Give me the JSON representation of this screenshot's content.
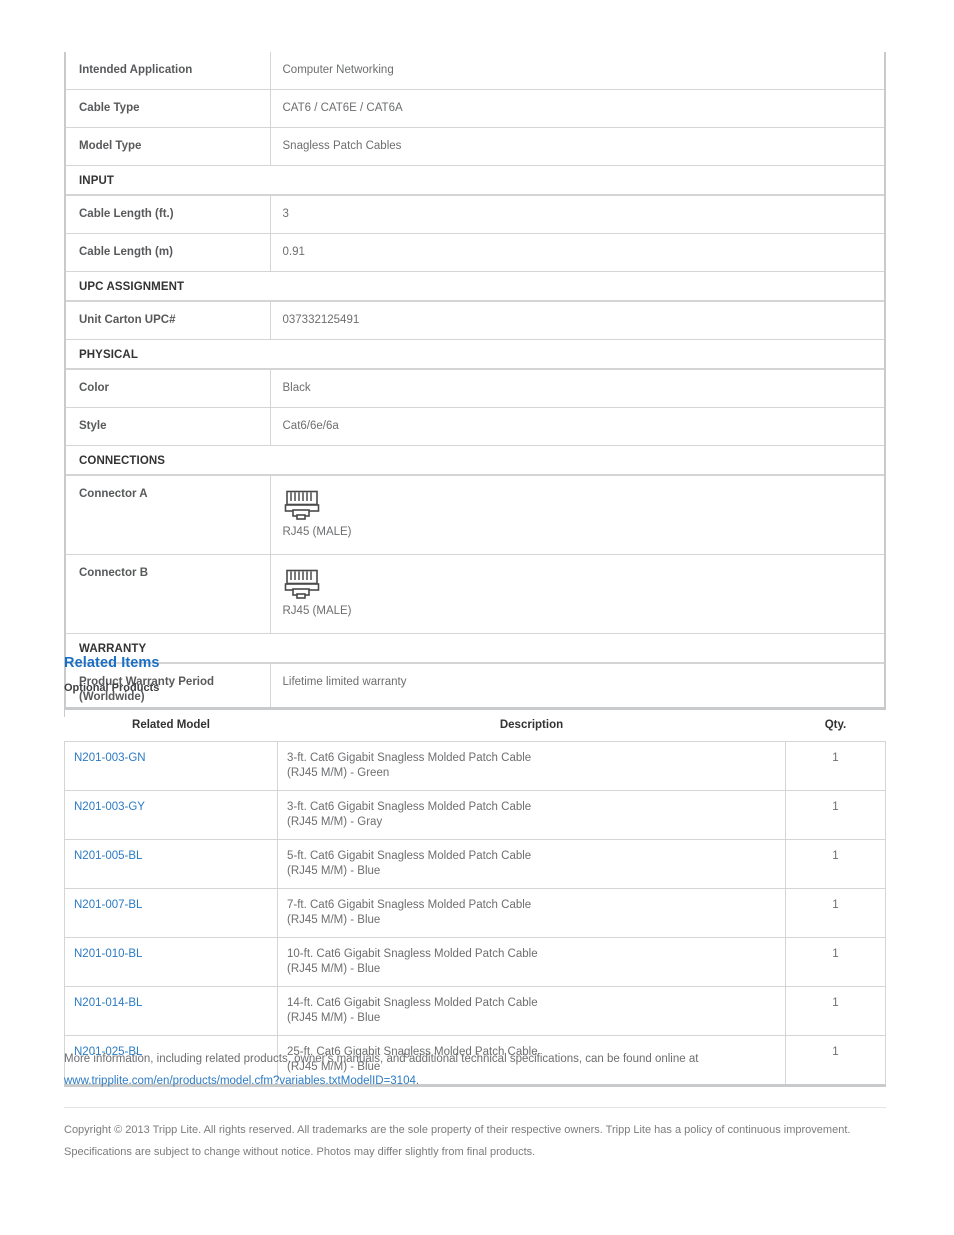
{
  "spec_table": {
    "rows": [
      {
        "kind": "row",
        "label": "Intended Application",
        "value": "Computer Networking"
      },
      {
        "kind": "row",
        "label": "Cable Type",
        "value": "CAT6 / CAT6E / CAT6A"
      },
      {
        "kind": "row",
        "label": "Model Type",
        "value": "Snagless Patch Cables"
      },
      {
        "kind": "section",
        "label": "INPUT"
      },
      {
        "kind": "row",
        "label": "Cable Length (ft.)",
        "value": "3"
      },
      {
        "kind": "row",
        "label": "Cable Length (m)",
        "value": "0.91"
      },
      {
        "kind": "section",
        "label": "UPC ASSIGNMENT"
      },
      {
        "kind": "row",
        "label": "Unit Carton UPC#",
        "value": "037332125491"
      },
      {
        "kind": "section",
        "label": "PHYSICAL"
      },
      {
        "kind": "row",
        "label": "Color",
        "value": "Black"
      },
      {
        "kind": "row",
        "label": "Style",
        "value": "Cat6/6e/6a"
      },
      {
        "kind": "section",
        "label": "CONNECTIONS"
      },
      {
        "kind": "connector",
        "label": "Connector A",
        "value": "RJ45 (MALE)",
        "icon": "rj45-connector-icon"
      },
      {
        "kind": "connector",
        "label": "Connector B",
        "value": "RJ45 (MALE)",
        "icon": "rj45-connector-icon"
      },
      {
        "kind": "section",
        "label": "WARRANTY"
      },
      {
        "kind": "row",
        "label": "Product Warranty Period (Worldwide)",
        "value": "Lifetime limited warranty"
      }
    ]
  },
  "related": {
    "heading": "Related Items",
    "subheading": "Optional Products",
    "columns": [
      "Related Model",
      "Description",
      "Qty."
    ],
    "rows": [
      {
        "model": "N201-003-GN",
        "description": "3-ft. Cat6 Gigabit Snagless Molded Patch Cable (RJ45 M/M) - Green",
        "qty": "1"
      },
      {
        "model": "N201-003-GY",
        "description": "3-ft. Cat6 Gigabit Snagless Molded Patch Cable (RJ45 M/M) - Gray",
        "qty": "1"
      },
      {
        "model": "N201-005-BL",
        "description": "5-ft. Cat6 Gigabit Snagless Molded Patch Cable (RJ45 M/M) - Blue",
        "qty": "1"
      },
      {
        "model": "N201-007-BL",
        "description": "7-ft. Cat6 Gigabit Snagless Molded Patch Cable (RJ45 M/M) - Blue",
        "qty": "1"
      },
      {
        "model": "N201-010-BL",
        "description": "10-ft. Cat6 Gigabit Snagless Molded Patch Cable (RJ45 M/M) - Blue",
        "qty": "1"
      },
      {
        "model": "N201-014-BL",
        "description": "14-ft. Cat6 Gigabit Snagless Molded Patch Cable (RJ45 M/M) - Blue",
        "qty": "1"
      },
      {
        "model": "N201-025-BL",
        "description": "25-ft. Cat6 Gigabit Snagless Molded Patch Cable (RJ45 M/M) - Blue",
        "qty": "1"
      }
    ]
  },
  "footer": {
    "more_info_text": "More information, including related products, owner's manuals, and additional technical specifications, can be found online at",
    "more_info_link": "www.tripplite.com/en/products/model.cfm?variables.txtModelID=3104",
    "more_info_period": ".",
    "copyright": "Copyright © 2013 Tripp Lite. All rights reserved. All trademarks are the sole property of their respective owners. Tripp Lite has a policy of continuous improvement. Specifications are subject to change without notice. Photos may differ slightly from final products."
  },
  "colors": {
    "link": "#2b7ac4",
    "heading_blue": "#1a6fc4",
    "label_gray": "#58595b",
    "value_gray": "#6d6e70",
    "border": "#d4d5d7",
    "border_strong": "#c9cacc"
  }
}
